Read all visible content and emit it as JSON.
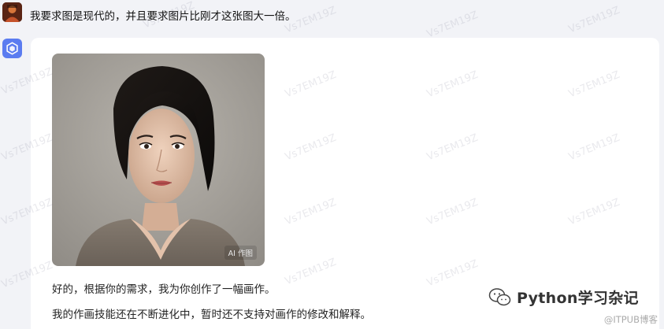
{
  "conversation": {
    "user_message": "我要求图是现代的，并且要求图片比刚才这张图大一倍。",
    "bot": {
      "image_badge": "AI 作图",
      "reply_line_1": "好的，根据你的需求，我为你创作了一幅画作。",
      "reply_line_2": "我的作画技能还在不断进化中，暂时还不支持对画作的修改和解释。"
    }
  },
  "overlays": {
    "watermark_text": "Vs7EM19Z",
    "brand_name": "Python学习杂记",
    "source_mark": "@ITPUB博客"
  },
  "icons": {
    "user_avatar": "user-avatar-icon",
    "bot_avatar": "hexagon-cube-icon",
    "brand": "wechat-icon"
  },
  "colors": {
    "page_bg": "#f2f3f7",
    "card_bg": "#ffffff",
    "bot_accent": "#5b7cf0"
  }
}
